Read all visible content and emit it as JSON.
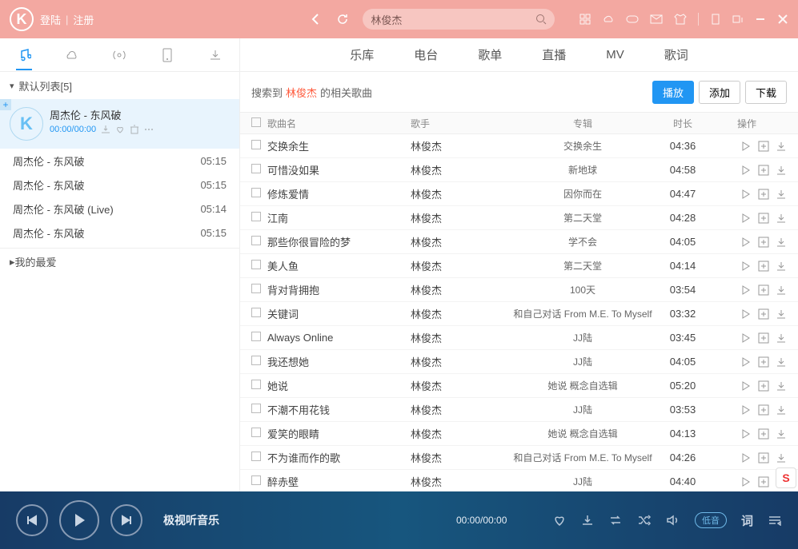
{
  "titlebar": {
    "login": "登陆",
    "register": "注册",
    "search_value": "林俊杰"
  },
  "sidebar": {
    "playlist_header": "默认列表[5]",
    "nowplaying": {
      "title": "周杰伦 - 东风破",
      "time": "00:00/00:00"
    },
    "tracks": [
      {
        "title": "周杰伦 - 东风破",
        "dur": "05:15"
      },
      {
        "title": "周杰伦 - 东风破",
        "dur": "05:15"
      },
      {
        "title": "周杰伦 - 东风破 (Live)",
        "dur": "05:14"
      },
      {
        "title": "周杰伦 - 东风破",
        "dur": "05:15"
      }
    ],
    "favorites": "我的最爱"
  },
  "main": {
    "tabs": [
      "乐库",
      "电台",
      "歌单",
      "直播",
      "MV",
      "歌词"
    ],
    "search_prefix": "搜索到",
    "search_keyword": "林俊杰",
    "search_suffix": "的相关歌曲",
    "btn_play": "播放",
    "btn_add": "添加",
    "btn_download": "下载",
    "headers": {
      "name": "歌曲名",
      "artist": "歌手",
      "album": "专辑",
      "dur": "时长",
      "ops": "操作"
    },
    "songs": [
      {
        "name": "交换余生",
        "artist": "林俊杰",
        "album": "交换余生",
        "dur": "04:36"
      },
      {
        "name": "可惜没如果",
        "artist": "林俊杰",
        "album": "新地球",
        "dur": "04:58"
      },
      {
        "name": "修炼爱情",
        "artist": "林俊杰",
        "album": "因你而在",
        "dur": "04:47"
      },
      {
        "name": "江南",
        "artist": "林俊杰",
        "album": "第二天堂",
        "dur": "04:28"
      },
      {
        "name": "那些你很冒险的梦",
        "artist": "林俊杰",
        "album": "学不会",
        "dur": "04:05"
      },
      {
        "name": "美人鱼",
        "artist": "林俊杰",
        "album": "第二天堂",
        "dur": "04:14"
      },
      {
        "name": "背对背拥抱",
        "artist": "林俊杰",
        "album": "100天",
        "dur": "03:54"
      },
      {
        "name": "关键词",
        "artist": "林俊杰",
        "album": "和自己对话 From M.E. To Myself",
        "dur": "03:32"
      },
      {
        "name": "Always Online",
        "artist": "林俊杰",
        "album": "JJ陆",
        "dur": "03:45"
      },
      {
        "name": "我还想她",
        "artist": "林俊杰",
        "album": "JJ陆",
        "dur": "04:05"
      },
      {
        "name": "她说",
        "artist": "林俊杰",
        "album": "她说 概念自选辑",
        "dur": "05:20"
      },
      {
        "name": "不潮不用花钱",
        "artist": "林俊杰",
        "album": "JJ陆",
        "dur": "03:53"
      },
      {
        "name": "爱笑的眼睛",
        "artist": "林俊杰",
        "album": "她说 概念自选辑",
        "dur": "04:13"
      },
      {
        "name": "不为谁而作的歌",
        "artist": "林俊杰",
        "album": "和自己对话 From M.E. To Myself",
        "dur": "04:26"
      },
      {
        "name": "醉赤壁",
        "artist": "林俊杰",
        "album": "JJ陆",
        "dur": "04:40"
      }
    ]
  },
  "player": {
    "title": "极视听音乐",
    "time": "00:00/00:00",
    "sound_label": "低音",
    "lyric": "词"
  },
  "ime": "S"
}
